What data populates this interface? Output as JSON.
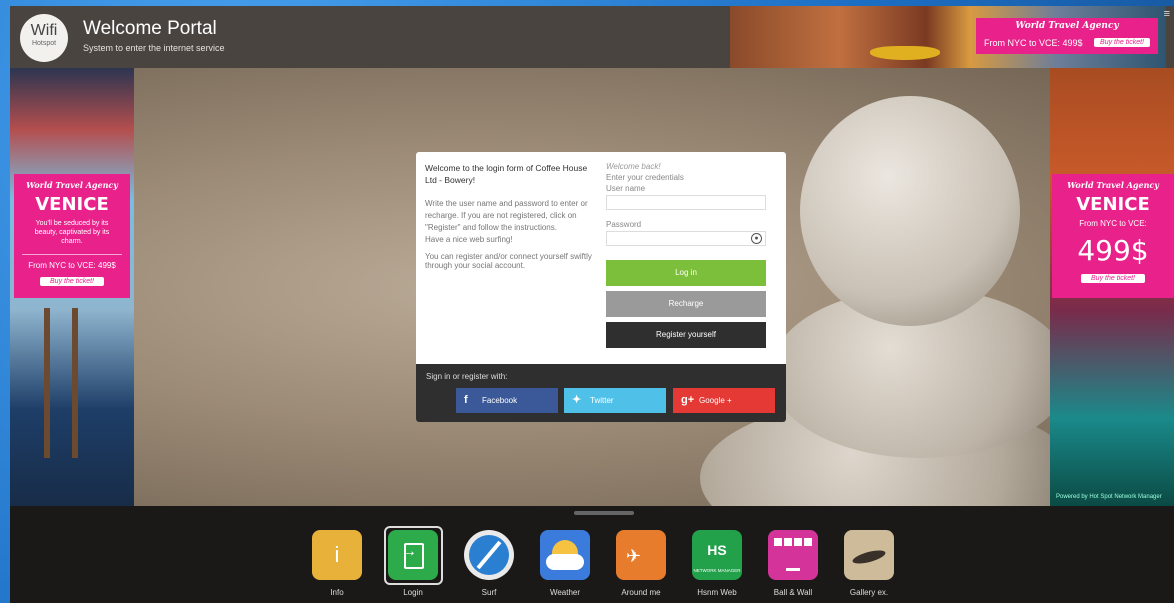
{
  "header": {
    "logo_main": "Wifi",
    "logo_sub": "Hotspot",
    "title": "Welcome Portal",
    "subtitle": "System to enter the internet service",
    "menu_icon": "menu-icon"
  },
  "top_banner": {
    "agency": "World Travel Agency",
    "route": "From NYC to VCE: 499$",
    "ticket": "Buy the ticket!"
  },
  "left_ad": {
    "agency": "World Travel Agency",
    "title": "VENICE",
    "description": "You'll be seduced by its beauty, captivated by its charm.",
    "route": "From NYC to VCE: 499$",
    "ticket": "Buy the ticket!"
  },
  "right_ad": {
    "agency": "World Travel Agency",
    "title": "VENICE",
    "route": "From NYC to VCE:",
    "price": "499$",
    "ticket": "Buy the ticket!",
    "powered": "Powered by Hot Spot Network Manager"
  },
  "login": {
    "heading": "Welcome to the login form of Coffee House Ltd - Bowery!",
    "instructions": "Write the user name and password to enter or recharge. If you are not registered, click on \"Register\" and follow the instructions.",
    "surfing": "Have a nice web surfing!",
    "social_note": "You can register and/or connect yourself swiftly through your social account.",
    "welcome_back": "Welcome back!",
    "enter_credentials": "Enter your credentials",
    "username_label": "User name",
    "username_value": "",
    "password_label": "Password",
    "password_value": "",
    "login_button": "Log in",
    "recharge_button": "Recharge",
    "register_button": "Register yourself",
    "social_label": "Sign in or register with:",
    "facebook": "Facebook",
    "twitter": "Twitter",
    "google": "Google +"
  },
  "dock": {
    "selected": "Login",
    "items": [
      {
        "label": "Info",
        "icon": "info-icon"
      },
      {
        "label": "Login",
        "icon": "login-icon"
      },
      {
        "label": "Surf",
        "icon": "compass-icon"
      },
      {
        "label": "Weather",
        "icon": "weather-icon"
      },
      {
        "label": "Around me",
        "icon": "map-icon"
      },
      {
        "label": "Hsnm Web",
        "icon": "hsnm-icon"
      },
      {
        "label": "Ball & Wall",
        "icon": "game-icon"
      },
      {
        "label": "Gallery ex.",
        "icon": "gallery-icon"
      }
    ],
    "hsnm_icon_text": "HS",
    "hsnm_icon_sub": "NETWORK MANAGER",
    "info_icon_glyph": "i"
  },
  "colors": {
    "accent_pink": "#e8228a",
    "login_green": "#7cbf3a",
    "facebook_blue": "#3b5998",
    "twitter_blue": "#4fc1e9",
    "google_red": "#e53935"
  }
}
